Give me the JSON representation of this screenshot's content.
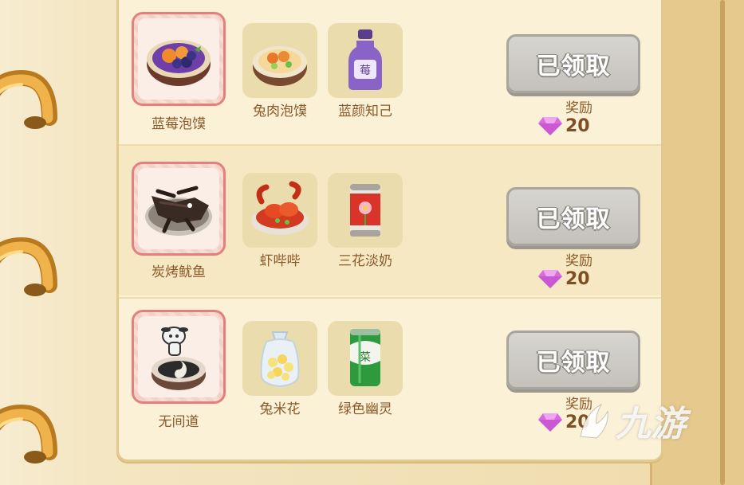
{
  "rows": [
    {
      "main_item": {
        "label": "蓝莓泡馍",
        "icon": "blueberry-bun-soup"
      },
      "items": [
        {
          "label": "兔肉泡馍",
          "icon": "rabbit-bun-soup"
        },
        {
          "label": "蓝颜知己",
          "icon": "blueberry-drink-bottle"
        }
      ],
      "button_label": "已领取",
      "reward_label": "奖励",
      "reward_amount": "20"
    },
    {
      "main_item": {
        "label": "炭烤鱿鱼",
        "icon": "grilled-squid"
      },
      "items": [
        {
          "label": "虾哔哔",
          "icon": "crayfish-plate"
        },
        {
          "label": "三花淡奶",
          "icon": "evaporated-milk-can"
        }
      ],
      "button_label": "已领取",
      "reward_label": "奖励",
      "reward_amount": "20"
    },
    {
      "main_item": {
        "label": "无间道",
        "icon": "taiji-bowl"
      },
      "items": [
        {
          "label": "兔米花",
          "icon": "popcorn-bag"
        },
        {
          "label": "绿色幽灵",
          "icon": "green-drink-can"
        }
      ],
      "button_label": "已领取",
      "reward_label": "奖励",
      "reward_amount": "20"
    }
  ],
  "colors": {
    "panel": "#fbf1d6",
    "claimed_button": "#cfcdc8",
    "label_text": "#8a5a2b",
    "gem": "#d96ae0"
  },
  "watermark": "九游"
}
